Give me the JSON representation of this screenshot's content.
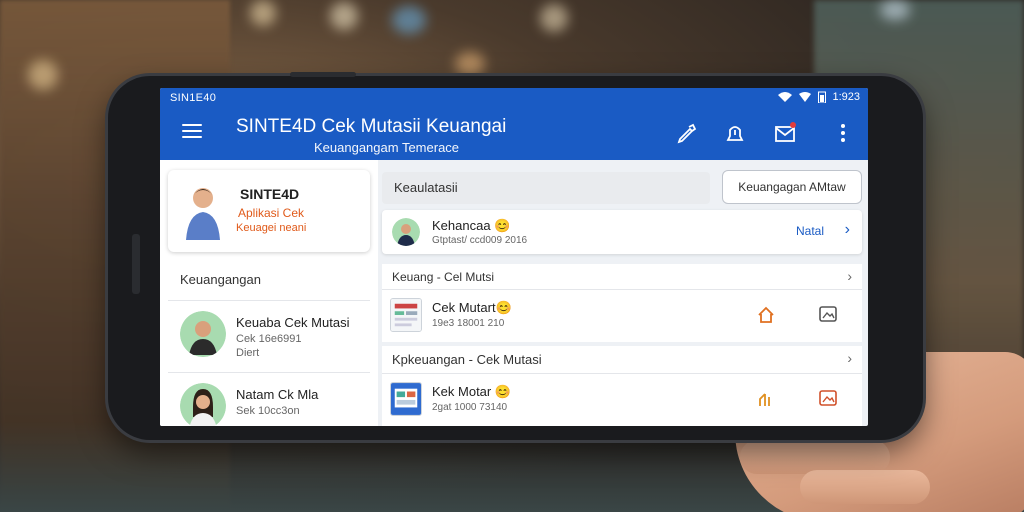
{
  "status_bar": {
    "time_left": "SIN1E40",
    "time_right": "1:923"
  },
  "header": {
    "title": "SINTE4D Cek Mutasii Keuangai",
    "subtitle": "Keuangangam Temerace"
  },
  "profile": {
    "name": "SINTE4D",
    "line1": "Aplikasi Cek",
    "line2": "Keuagei neani"
  },
  "left_section_title": "Keuangangan",
  "contacts": [
    {
      "name": "Keuaba Cek Mutasi",
      "line2": "Cek 16e6991",
      "line3": "Diert"
    },
    {
      "name": "Natam Ck Mla",
      "line2": "Sek 10cc3on",
      "line3": ""
    }
  ],
  "search": {
    "value": "Keaulatasii"
  },
  "filter_button": "Keuangagan AMtaw",
  "pinned": {
    "name": "Kehancaa 😊",
    "sub": "Gtptast/ ccd009 2016",
    "action": "Natal"
  },
  "groups": [
    {
      "title": "Keuang - Cel Mutsi",
      "item": {
        "name": "Cek Mutart😊",
        "sub": "19e3 18001 210"
      }
    },
    {
      "title": "Kpkeuangan - Cek Mutasi",
      "item": {
        "name": "Kek Motar 😊",
        "sub": "2gat 1000 73140"
      }
    }
  ],
  "colors": {
    "primary": "#1a5bc4",
    "accent": "#e05a1a",
    "background": "#eef1f5"
  },
  "icons": [
    "menu-icon",
    "edit-icon",
    "alert-icon",
    "mail-icon",
    "more-icon",
    "home-icon",
    "image-icon",
    "chevron-right-icon"
  ]
}
